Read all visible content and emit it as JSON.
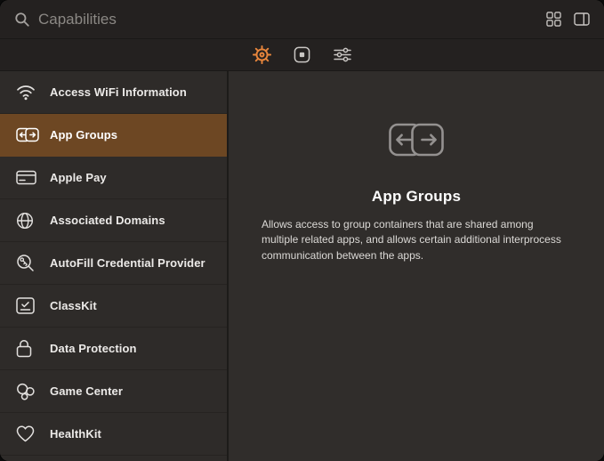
{
  "colors": {
    "accent": "#e8863c",
    "selection": "#6d4723",
    "background": "#2e2b29"
  },
  "search": {
    "placeholder": "Capabilities"
  },
  "top_actions": [
    {
      "icon": "grid-view-icon"
    },
    {
      "icon": "panel-view-icon"
    }
  ],
  "toolbar": {
    "tabs": [
      {
        "icon": "capabilities-gear-icon",
        "active": true
      },
      {
        "icon": "snippet-square-icon",
        "active": false
      },
      {
        "icon": "filter-sliders-icon",
        "active": false
      }
    ]
  },
  "sidebar": {
    "items": [
      {
        "label": "Access WiFi Information",
        "icon": "wifi-icon",
        "selected": false
      },
      {
        "label": "App Groups",
        "icon": "app-groups-icon",
        "selected": true
      },
      {
        "label": "Apple Pay",
        "icon": "credit-card-icon",
        "selected": false
      },
      {
        "label": "Associated Domains",
        "icon": "globe-icon",
        "selected": false
      },
      {
        "label": "AutoFill Credential Provider",
        "icon": "key-magnifier-icon",
        "selected": false
      },
      {
        "label": "ClassKit",
        "icon": "checklist-icon",
        "selected": false
      },
      {
        "label": "Data Protection",
        "icon": "lock-icon",
        "selected": false
      },
      {
        "label": "Game Center",
        "icon": "bubbles-icon",
        "selected": false
      },
      {
        "label": "HealthKit",
        "icon": "heart-icon",
        "selected": false
      }
    ]
  },
  "detail": {
    "title": "App Groups",
    "description": "Allows access to group containers that are shared among multiple related apps, and allows certain additional interprocess communication between the apps."
  }
}
